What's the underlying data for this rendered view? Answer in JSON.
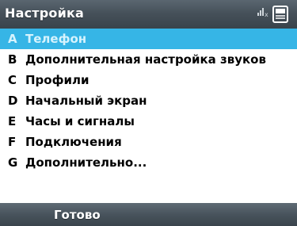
{
  "header": {
    "title": "Настройка",
    "icons": [
      "signal-icon",
      "battery-inbox-icon"
    ]
  },
  "menu": {
    "items": [
      {
        "key": "A",
        "label": "Телефон",
        "selected": true
      },
      {
        "key": "B",
        "label": "Дополнительная настройка звуков",
        "selected": false
      },
      {
        "key": "C",
        "label": "Профили",
        "selected": false
      },
      {
        "key": "D",
        "label": "Начальный экран",
        "selected": false
      },
      {
        "key": "E",
        "label": "Часы и сигналы",
        "selected": false
      },
      {
        "key": "F",
        "label": "Подключения",
        "selected": false
      },
      {
        "key": "G",
        "label": "Дополнительно...",
        "selected": false
      }
    ]
  },
  "softkeys": {
    "left_label": "Готово"
  },
  "colors": {
    "selection": "#36b5e6",
    "bar": "#46515a",
    "text": "#000000"
  }
}
